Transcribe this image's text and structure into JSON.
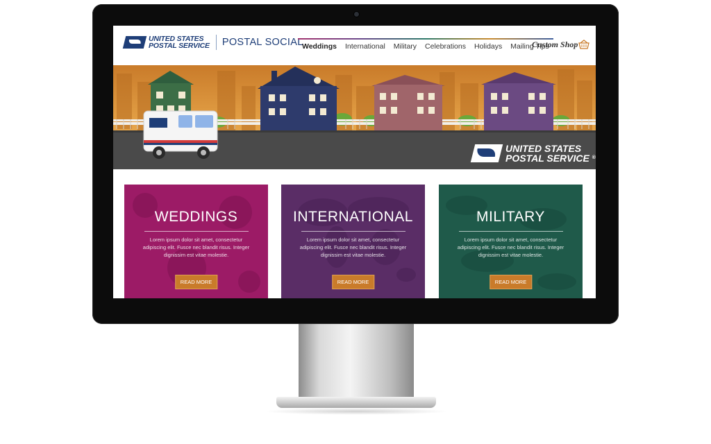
{
  "header": {
    "logo_line1": "UNITED STATES",
    "logo_line2": "POSTAL SERVICE",
    "site_name": "POSTAL SOCIAL",
    "nav": [
      "Weddings",
      "International",
      "Military",
      "Celebrations",
      "Holidays",
      "Mailing Tips"
    ],
    "custom_shop": "Custom Shop"
  },
  "hero": {
    "brand_line1": "UNITED STATES",
    "brand_line2": "POSTAL SERVICE",
    "registered": "®"
  },
  "cards": [
    {
      "title": "WEDDINGS",
      "body": "Lorem ipsum dolor sit amet, consectetur adipiscing elit. Fusce nec blandit risus. Integer dignissim est vitae molestie.",
      "button": "READ MORE",
      "color": "#9c1b66"
    },
    {
      "title": "INTERNATIONAL",
      "body": "Lorem ipsum dolor sit amet, consectetur adipiscing elit. Fusce nec blandit risus. Integer dignissim est vitae molestie.",
      "button": "READ MORE",
      "color": "#5a2d66"
    },
    {
      "title": "MILITARY",
      "body": "Lorem ipsum dolor sit amet, consectetur adipiscing elit. Fusce nec blandit risus. Integer dignissim est vitae molestie.",
      "button": "READ MORE",
      "color": "#1f5a4a"
    }
  ],
  "colors": {
    "brand_blue": "#1e3e78",
    "button_orange": "#c97b2a"
  },
  "icons": {
    "basket": "basket-icon",
    "camera": "camera-icon"
  }
}
